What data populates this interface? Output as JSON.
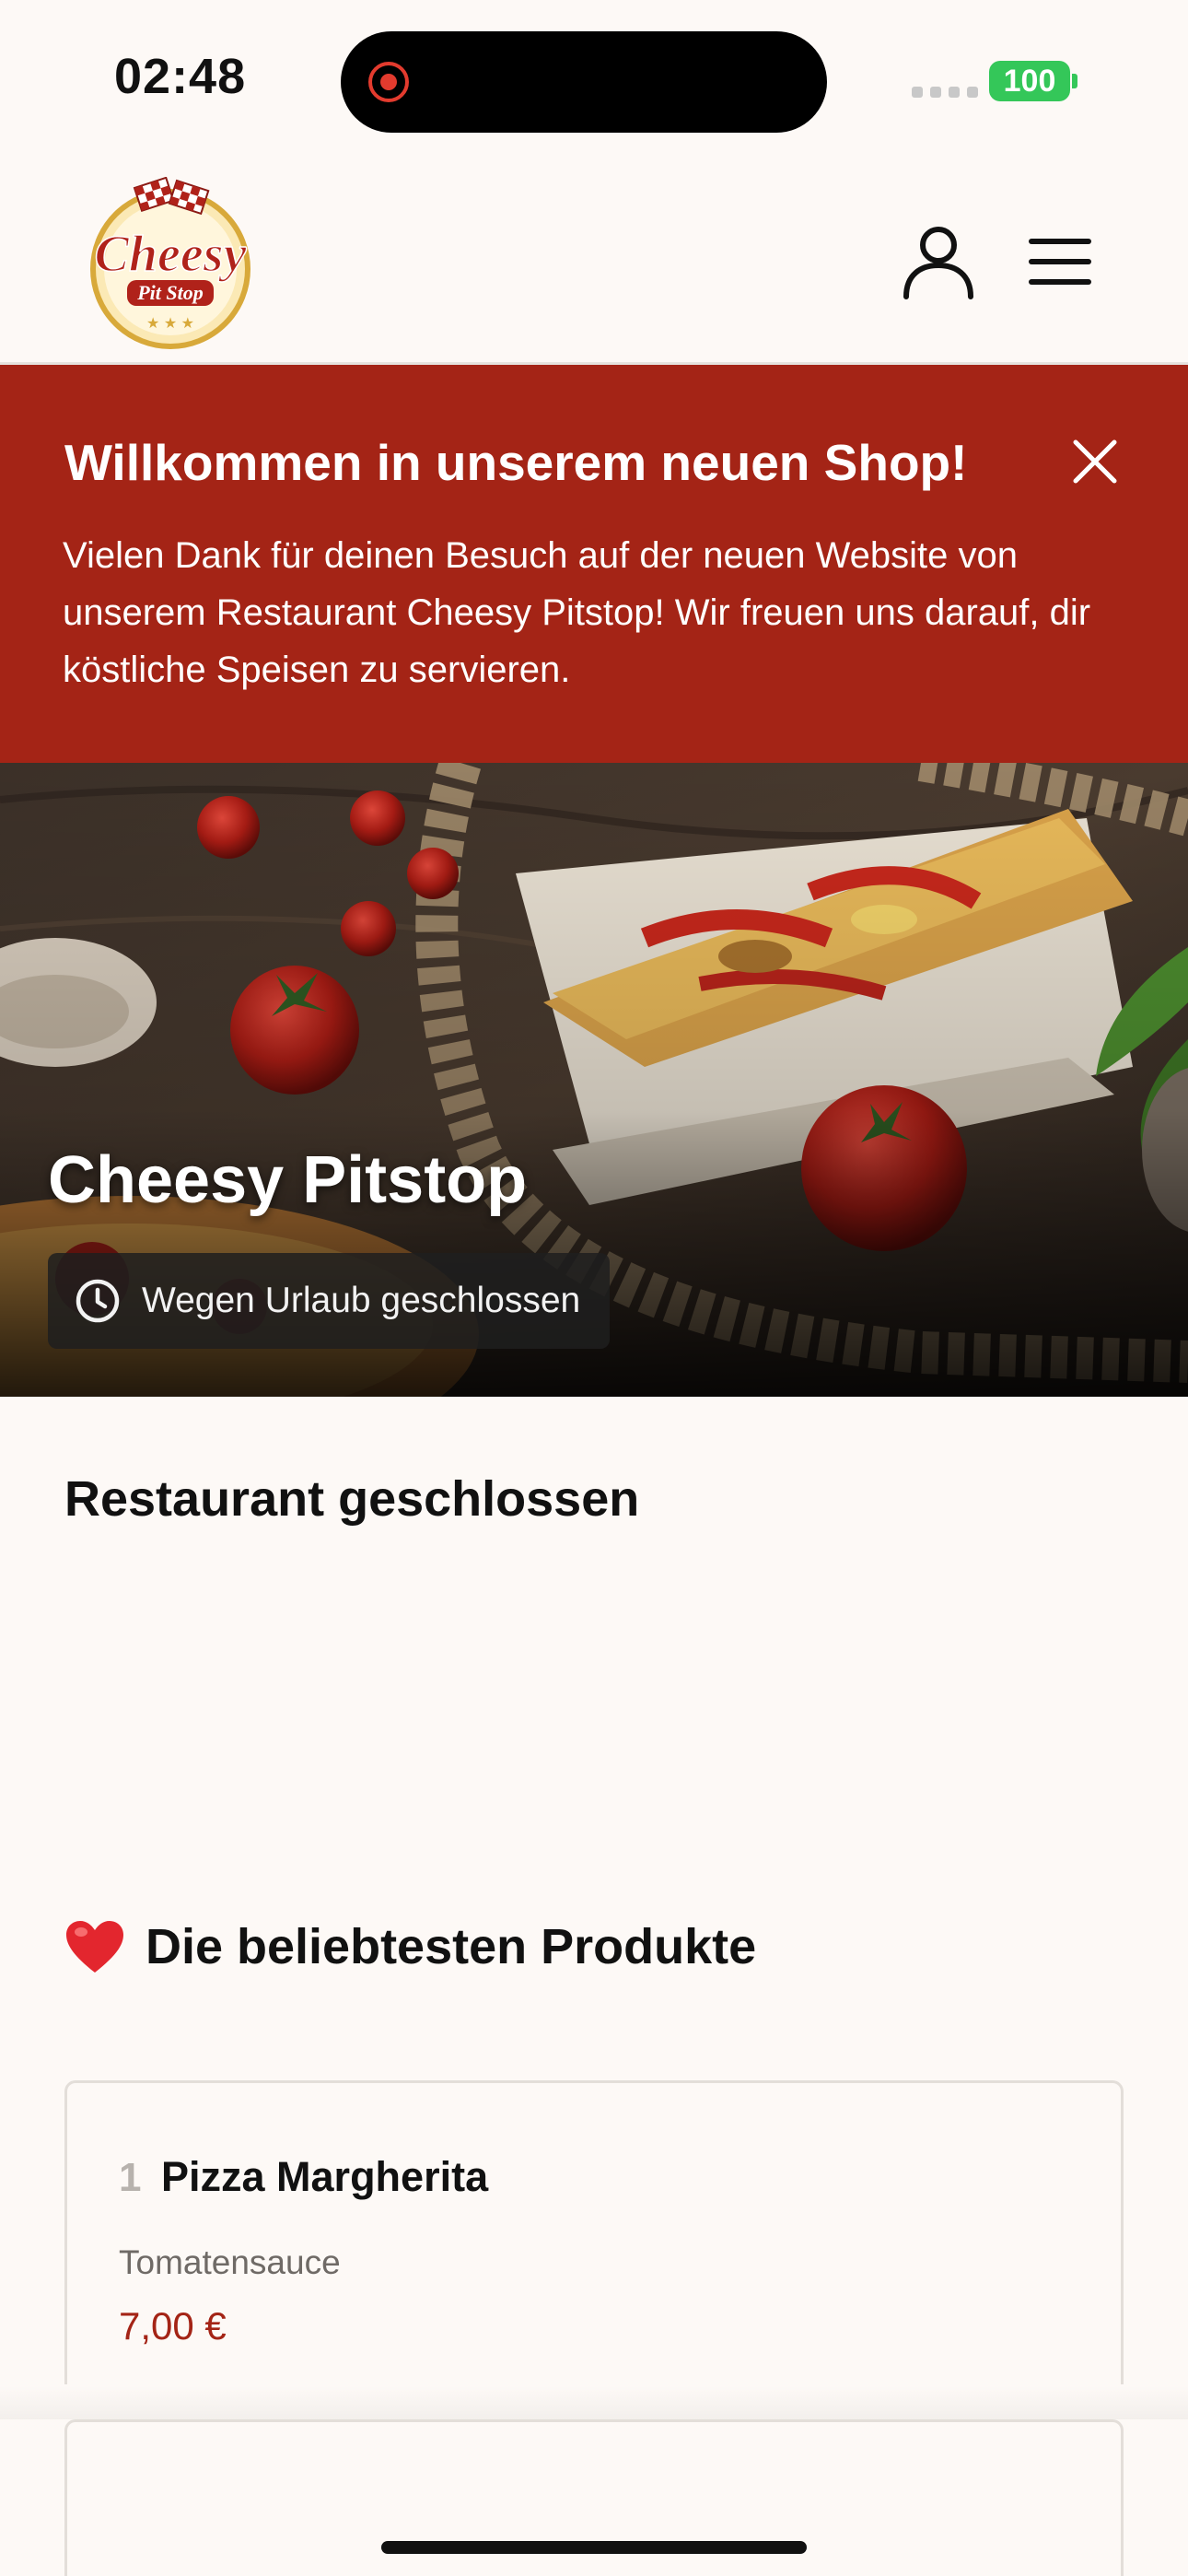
{
  "status_bar": {
    "time": "02:48",
    "battery": "100",
    "icons": [
      "screen-recording-icon",
      "signal-icon",
      "battery-icon"
    ]
  },
  "header": {
    "logo_text": "Cheesy",
    "logo_subtext": "Pit Stop",
    "icons": [
      "user-icon",
      "menu-icon"
    ]
  },
  "banner": {
    "title": "Willkommen in unserem neuen Shop!",
    "text": "Vielen Dank für deinen Besuch auf der neuen Website von unserem Restaurant Cheesy Pitstop! Wir freuen uns darauf, dir köstliche Speisen zu servieren.",
    "close_icon": "close-icon",
    "background_color": "#a42416"
  },
  "hero": {
    "title": "Cheesy Pitstop",
    "status": "Wegen Urlaub geschlossen",
    "status_icon": "clock-icon"
  },
  "closed_section": {
    "heading": "Restaurant geschlossen"
  },
  "popular": {
    "heading": "Die beliebtesten Produkte",
    "icon": "heart-icon",
    "products": [
      {
        "rank": "1",
        "name": "Pizza Margherita",
        "description": "Tomatensauce",
        "price": "7,00 €"
      }
    ]
  },
  "colors": {
    "accent": "#a42416",
    "background": "#fdf9f6"
  }
}
